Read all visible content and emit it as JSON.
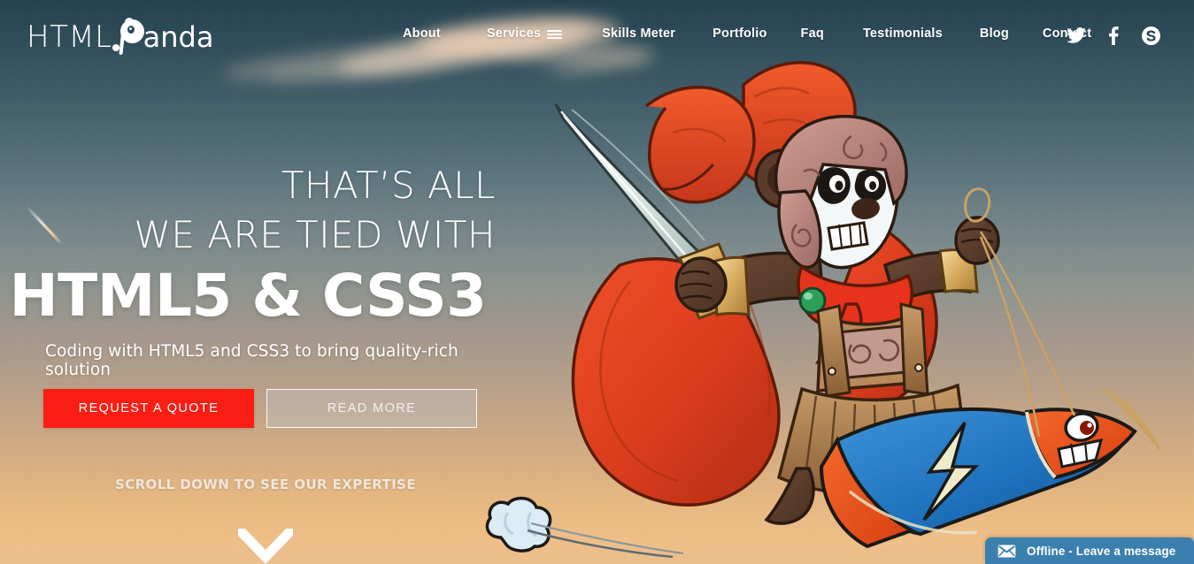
{
  "site": {
    "logo_primary": "HTML",
    "logo_secondary": "anda",
    "logo_full": "HTML Panda"
  },
  "nav": {
    "items": [
      {
        "label": "About",
        "icon": null,
        "active": false
      },
      {
        "label": "Services",
        "icon": "hamburger-icon",
        "active": true
      },
      {
        "label": "Skills Meter",
        "icon": null,
        "active": false
      },
      {
        "label": "Portfolio",
        "icon": null,
        "active": false
      },
      {
        "label": "Faq",
        "icon": null,
        "active": false
      },
      {
        "label": "Testimonials",
        "icon": null,
        "active": false
      },
      {
        "label": "Blog",
        "icon": null,
        "active": false
      },
      {
        "label": "Contact",
        "icon": null,
        "active": false
      }
    ],
    "social": [
      {
        "name": "twitter-icon",
        "label": "Twitter"
      },
      {
        "name": "facebook-icon",
        "label": "Facebook"
      },
      {
        "name": "skype-icon",
        "label": "Skype"
      }
    ]
  },
  "hero": {
    "headline_line1": "THAT’S ALL",
    "headline_line2": "WE ARE TIED WITH",
    "headline_emphasis": "HTML5 & CSS3",
    "subheadline": "Coding with HTML5 and CSS3 to bring quality-rich solution",
    "cta_primary": "REQUEST A QUOTE",
    "cta_secondary": "READ MORE",
    "scroll_prompt": "SCROLL DOWN TO SEE OUR EXPERTISE",
    "scroll_icon": "chevron-down-icon"
  },
  "chat": {
    "status_label": "Offline - Leave a message",
    "icon": "envelope-icon"
  },
  "artwork": {
    "mascot": "warrior-panda-riding-fish-kite",
    "elements": [
      "sword",
      "red-cape",
      "helmet",
      "red-scarf",
      "fish-kite",
      "cloud",
      "shooting-star"
    ]
  },
  "colors": {
    "accent_red": "#FA1D13",
    "sky_top": "#24424F",
    "sky_bottom": "#EDBF8C",
    "chat_blue": "#3B7FAE",
    "text_white": "#FFFFFF"
  }
}
